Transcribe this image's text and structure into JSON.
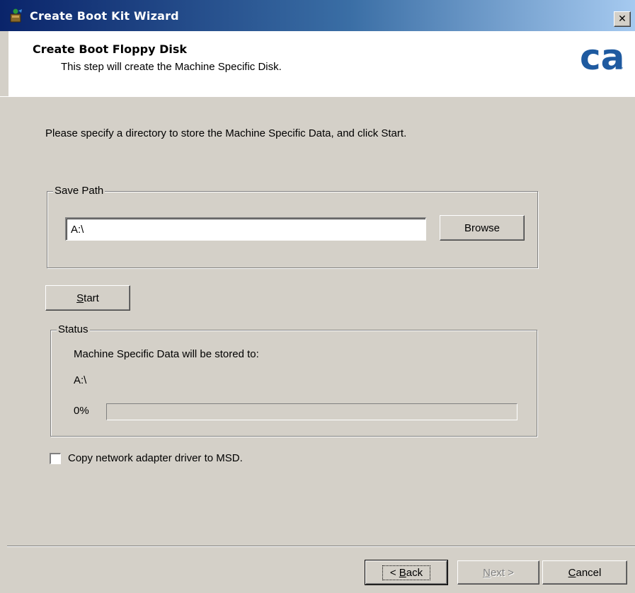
{
  "window": {
    "title": "Create Boot Kit Wizard",
    "close_glyph": "✕"
  },
  "header": {
    "title": "Create Boot Floppy Disk",
    "subtitle": "This step will create the Machine Specific Disk.",
    "logo_text": "ca",
    "logo_tm": "™",
    "logo_color": "#1e5aa0"
  },
  "main": {
    "instructions": "Please specify a directory to store the Machine Specific Data, and click Start.",
    "save_path": {
      "group_label": "Save Path",
      "value": "A:\\",
      "browse_label": "Browse"
    },
    "start_label_first": "S",
    "start_label_rest": "tart",
    "status": {
      "group_label": "Status",
      "stored_text": "Machine Specific Data will be stored to:",
      "path": "A:\\",
      "percent_text": "0%",
      "progress_fraction": 0
    },
    "copy_checkbox": {
      "label": "Copy network adapter driver to MSD.",
      "checked": false
    }
  },
  "footer": {
    "back_lt": "< ",
    "back_u": "B",
    "back_rest": "ack",
    "next_u": "N",
    "next_rest": "ext >",
    "cancel_u": "C",
    "cancel_rest": "ancel"
  }
}
